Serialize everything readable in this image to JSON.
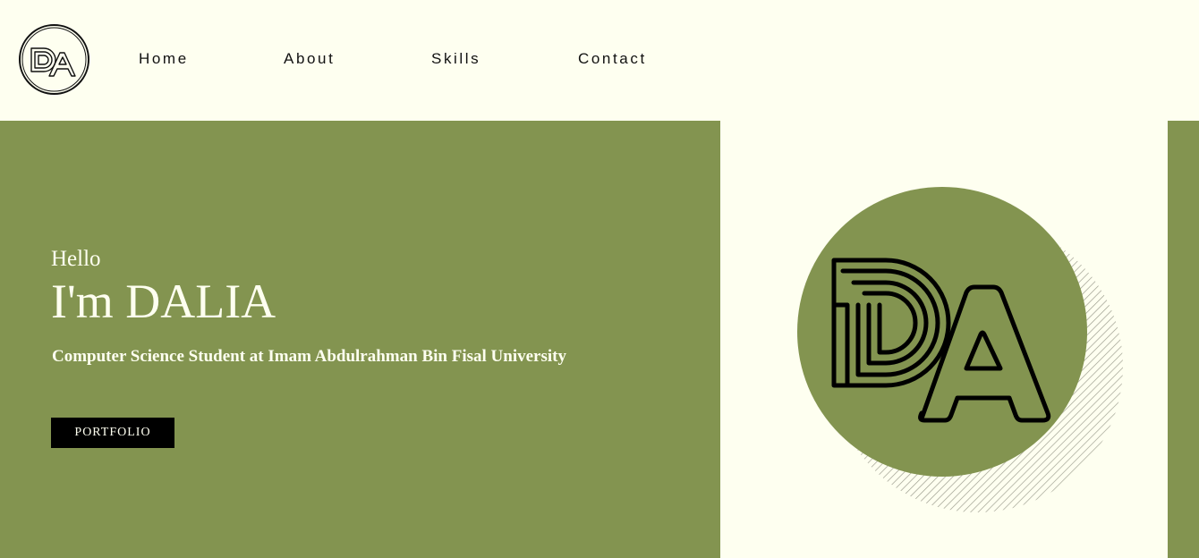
{
  "brand": {
    "logo_icon": "da-monogram-logo-icon"
  },
  "nav": {
    "items": [
      {
        "label": "Home"
      },
      {
        "label": "About"
      },
      {
        "label": "Skills"
      },
      {
        "label": "Contact"
      }
    ]
  },
  "hero": {
    "greeting": "Hello",
    "name": "I'm DALIA",
    "tagline": "Computer Science Student at Imam Abdulrahman Bin Fisal University",
    "button_label": "PORTFOLIO",
    "art_icon": "da-monogram-circle-illustration"
  },
  "colors": {
    "accent": "#839450",
    "background": "#fefff0",
    "text_dark": "#111111",
    "button": "#000000"
  }
}
